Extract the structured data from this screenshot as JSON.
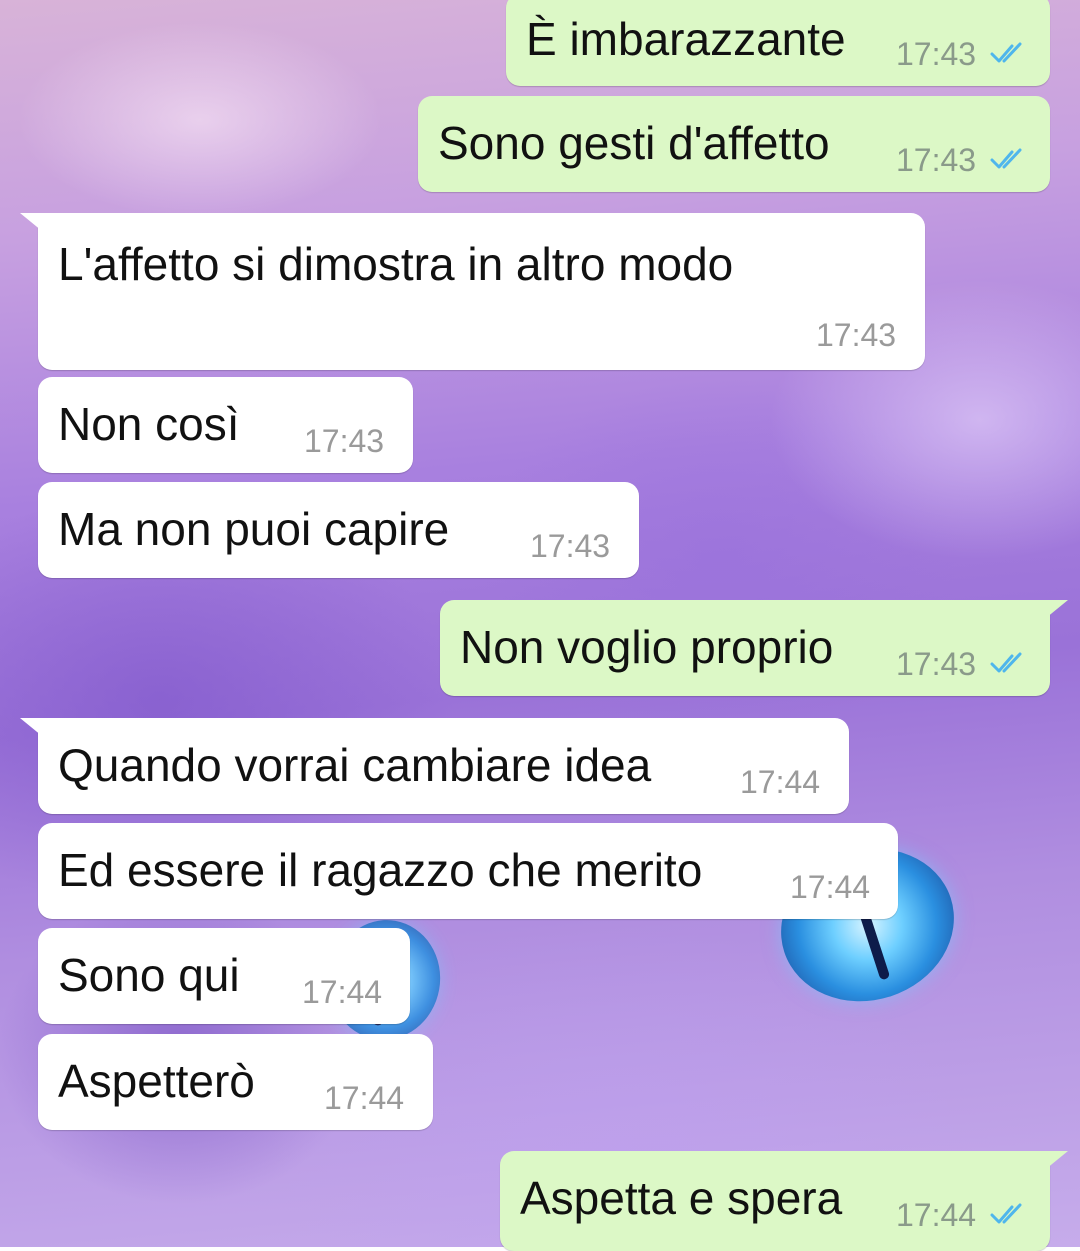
{
  "chat": {
    "messages": [
      {
        "direction": "outgoing",
        "text": "È imbarazzante",
        "time": "17:43",
        "status_icon": "double-check-icon"
      },
      {
        "direction": "outgoing",
        "text": "Sono gesti d'affetto",
        "time": "17:43",
        "status_icon": "double-check-icon"
      },
      {
        "direction": "incoming",
        "text": "L'affetto si dimostra in altro modo",
        "time": "17:43"
      },
      {
        "direction": "incoming",
        "text": "Non così",
        "time": "17:43"
      },
      {
        "direction": "incoming",
        "text": "Ma non puoi capire",
        "time": "17:43"
      },
      {
        "direction": "outgoing",
        "text": "Non voglio proprio",
        "time": "17:43",
        "status_icon": "double-check-icon"
      },
      {
        "direction": "incoming",
        "text": "Quando vorrai cambiare idea",
        "time": "17:44"
      },
      {
        "direction": "incoming",
        "text": "Ed essere il ragazzo che merito",
        "time": "17:44"
      },
      {
        "direction": "incoming",
        "text": "Sono qui",
        "time": "17:44"
      },
      {
        "direction": "incoming",
        "text": "Aspetterò",
        "time": "17:44"
      },
      {
        "direction": "outgoing",
        "text": "Aspetta e spera",
        "time": "17:44",
        "status_icon": "double-check-icon"
      }
    ]
  },
  "colors": {
    "outgoing_bubble": "#dcf8c6",
    "incoming_bubble": "#ffffff",
    "read_ticks": "#4fb6ec",
    "timestamp": "#9a9a9a"
  }
}
